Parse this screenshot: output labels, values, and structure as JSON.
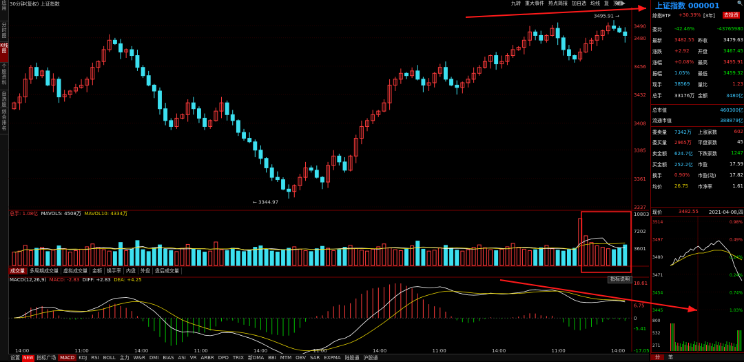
{
  "chart_title": "30分钟(复权)  上证指数",
  "left_tabs": [
    "应用",
    "分时图",
    "K线图",
    "个股资料",
    "自选股",
    "综合排名",
    "牛叉诊断",
    "更多"
  ],
  "top_toolbar": [
    "九转",
    "重大事件",
    "热点简报",
    "加自选",
    "均线",
    "复",
    "顶图"
  ],
  "price_axis": [
    "3490",
    "3480",
    "3456",
    "3432",
    "3408",
    "3385",
    "3361",
    "3337"
  ],
  "annotations": {
    "high": "3495.91",
    "low": "3344.97"
  },
  "volume": {
    "legend_label": "总手: 1.08亿",
    "ma5": "MAVOL5: 4508万",
    "ma10": "MAVOL10: 4334万",
    "axis": [
      "10803",
      "7202",
      "3601"
    ]
  },
  "volume_tabs": [
    "成交量",
    "多周期成交量",
    "虚拟成交量",
    "金额",
    "换手率",
    "内盘",
    "外盘",
    "盘后成交量"
  ],
  "indicator_button": "指标说明",
  "macd": {
    "params": "MACD(12,26,9)",
    "macd": "MACD: -2.83",
    "diff": "DIFF: +2.83",
    "dea": "DEA: +4.25",
    "axis": [
      "18.61",
      "6.75",
      "0",
      "-5.41",
      "-17.05"
    ]
  },
  "time_axis": [
    "14:00",
    "11:00",
    "14:00",
    "11:00",
    "14:00",
    "11:00",
    "14:00",
    "11:00",
    "14:00",
    "11:00",
    "14:00"
  ],
  "bottom_tabs": [
    "设置",
    "NEW",
    "指标广场",
    "MACD",
    "KDJ",
    "RSI",
    "BOLL",
    "主力",
    "W&R",
    "DMI",
    "BIAS",
    "ASI",
    "VR",
    "ARBR",
    "DPO",
    "TRIX",
    "新DMA",
    "BBI",
    "MTM",
    "OBV",
    "SAR",
    "EXPMA",
    "陆股通",
    "沪股通"
  ],
  "right_panel": {
    "title": "上证指数 000001",
    "search": "去搜索",
    "sub_label": "综指ETF",
    "sub_value": "+30.39%",
    "sub_period": "[3年]",
    "sub_tag": "去投资",
    "rows": [
      {
        "l1": "委比",
        "v1": "-42.46%",
        "c1": "green",
        "l2": "",
        "v2": "-43765980",
        "c2": "green"
      },
      {
        "l1": "最新",
        "v1": "3482.55",
        "c1": "red",
        "l2": "昨收",
        "v2": "3479.63",
        "c2": "white"
      },
      {
        "l1": "涨跌",
        "v1": "+2.92",
        "c1": "red",
        "l2": "开盘",
        "v2": "3467.45",
        "c2": "green"
      },
      {
        "l1": "涨幅",
        "v1": "+0.08%",
        "c1": "red",
        "l2": "最高",
        "v2": "3495.91",
        "c2": "red"
      },
      {
        "l1": "振幅",
        "v1": "1.05%",
        "c1": "cyan",
        "l2": "最低",
        "v2": "3459.32",
        "c2": "green"
      },
      {
        "l1": "现手",
        "v1": "38569",
        "c1": "cyan",
        "l2": "量比",
        "v2": "1.23",
        "c2": "red"
      },
      {
        "l1": "总手",
        "v1": "33176万",
        "c1": "white",
        "l2": "金额",
        "v2": "3480亿",
        "c2": "cyan"
      },
      {
        "l1": "总市值",
        "v1": "",
        "c1": "white",
        "l2": "",
        "v2": "460300亿",
        "c2": "cyan"
      },
      {
        "l1": "流通市值",
        "v1": "",
        "c1": "white",
        "l2": "",
        "v2": "388879亿",
        "c2": "cyan"
      },
      {
        "l1": "委卖量",
        "v1": "7342万",
        "c1": "cyan",
        "l2": "上涨家数",
        "v2": "602",
        "c2": "red"
      },
      {
        "l1": "委买量",
        "v1": "2965万",
        "c1": "red",
        "l2": "平盘家数",
        "v2": "45",
        "c2": "white"
      },
      {
        "l1": "卖金额",
        "v1": "624.7亿",
        "c1": "cyan",
        "l2": "下跌家数",
        "v2": "1247",
        "c2": "green"
      },
      {
        "l1": "买金额",
        "v1": "252.2亿",
        "c1": "cyan",
        "l2": "市盈",
        "v2": "17.59",
        "c2": "white"
      },
      {
        "l1": "换手",
        "v1": "0.90%",
        "c1": "red",
        "l2": "市盈(动)",
        "v2": "17.82",
        "c2": "white"
      },
      {
        "l1": "均价",
        "v1": "26.75",
        "c1": "yellow",
        "l2": "市净率",
        "v2": "1.61",
        "c2": "white"
      }
    ],
    "mini_header": {
      "label": "现价",
      "price": "3482.55",
      "date": "2021-04-08,四"
    },
    "mini_price_axis": [
      "3514",
      "3497",
      "3480",
      "3471",
      "3454",
      "3445"
    ],
    "mini_pct_axis": [
      "0.98%",
      "0.49%",
      "0.24%",
      "0.24%",
      "0.74%",
      "1.03%"
    ],
    "mini_vol_axis": [
      "800",
      "532",
      "271"
    ],
    "bottom_tabs": [
      "分",
      "笔"
    ]
  },
  "chart_data": {
    "type": "candlestick",
    "title": "30分钟(复权)  上证指数",
    "ylim": [
      3337,
      3505
    ],
    "up_color": "#ff3b3b",
    "down_color": "#3ce0f0",
    "ohlc_notes": "price path rises 3425→3475, falls to low 3344.97, recovers to high 3495.91",
    "close": [
      3425,
      3430,
      3445,
      3455,
      3448,
      3452,
      3440,
      3445,
      3430,
      3432,
      3435,
      3438,
      3440,
      3445,
      3455,
      3460,
      3470,
      3478,
      3475,
      3468,
      3470,
      3465,
      3455,
      3448,
      3440,
      3435,
      3420,
      3410,
      3405,
      3412,
      3415,
      3425,
      3420,
      3412,
      3405,
      3410,
      3418,
      3425,
      3415,
      3410,
      3400,
      3395,
      3392,
      3385,
      3378,
      3370,
      3362,
      3360,
      3352,
      3350,
      3355,
      3362,
      3370,
      3368,
      3362,
      3358,
      3372,
      3380,
      3375,
      3368,
      3380,
      3395,
      3405,
      3410,
      3415,
      3418,
      3425,
      3440,
      3445,
      3450,
      3448,
      3452,
      3445,
      3440,
      3442,
      3450,
      3455,
      3445,
      3440,
      3438,
      3442,
      3445,
      3450,
      3455,
      3460,
      3465,
      3458,
      3460,
      3465,
      3470,
      3472,
      3478,
      3485,
      3482,
      3478,
      3482,
      3488,
      3480,
      3470,
      3465,
      3462,
      3468,
      3475,
      3478,
      3482,
      3486,
      3490,
      3488,
      3485,
      3482
    ],
    "volume": [
      2800,
      3000,
      4200,
      3100,
      3600,
      3800,
      2900,
      3200,
      4100,
      3500,
      2800,
      3100,
      3400,
      3900,
      4500,
      3800,
      3300,
      3000,
      2900,
      4800,
      3100,
      3400,
      5200,
      3300,
      2900,
      3700,
      4300,
      3400,
      3100,
      2900,
      3600,
      4400,
      3500,
      3200,
      2800,
      3000,
      4900,
      3300,
      3100,
      3600,
      3000,
      2900,
      3200,
      3800,
      4100,
      3400,
      3000,
      2800,
      3300,
      3600,
      3900,
      3400,
      3100,
      2900,
      3500,
      4000,
      3600,
      3100,
      3300,
      3800,
      4200,
      3600,
      3200,
      3000,
      3400,
      3900,
      4500,
      3700,
      3300,
      3100,
      3500,
      4100,
      5100,
      3400,
      3000,
      3200,
      3700,
      4200,
      3600,
      3200,
      3000,
      3300,
      3800,
      4300,
      3700,
      3300,
      3100,
      3400,
      3900,
      4600,
      3800,
      3400,
      3100,
      3300,
      3700,
      4200,
      3500,
      3200,
      3000,
      3300,
      3600,
      9800,
      6200,
      4800,
      4100,
      3800,
      3500,
      3300,
      3700,
      4300
    ],
    "macd_ylim": [
      -17.05,
      18.61
    ]
  }
}
